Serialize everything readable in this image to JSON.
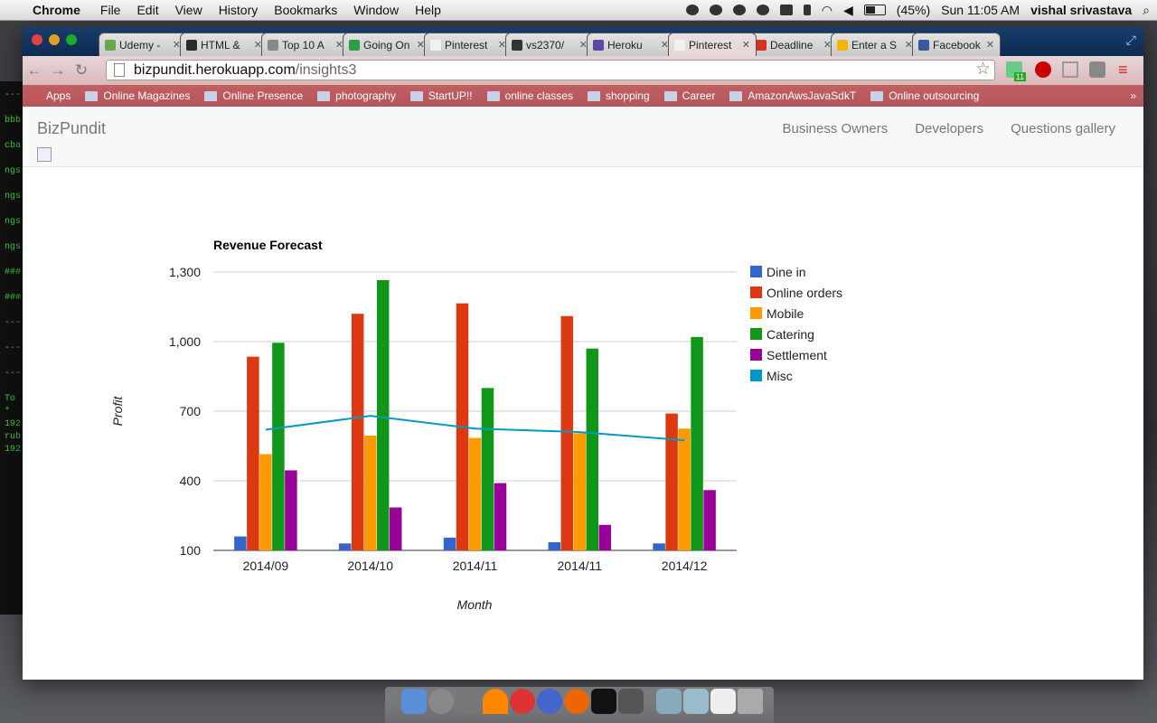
{
  "os_menubar": {
    "app_name": "Chrome",
    "menus": [
      "File",
      "Edit",
      "View",
      "History",
      "Bookmarks",
      "Window",
      "Help"
    ],
    "battery": "(45%)",
    "clock": "Sun 11:05 AM",
    "user": "vishal srivastava"
  },
  "terminal_lines": [
    "---",
    "bbb",
    "cba",
    "ngs",
    "ngs",
    "ngs",
    "ngs",
    "###",
    "###",
    "---",
    "---",
    "---",
    "To",
    " *",
    "192",
    "rub",
    "192"
  ],
  "browser": {
    "tabs": [
      {
        "label": "Udemy -",
        "fav_color": "#6aa84f",
        "active": false
      },
      {
        "label": "HTML &",
        "fav_color": "#2b2b2b",
        "active": false
      },
      {
        "label": "Top 10 A",
        "fav_color": "#888888",
        "active": false
      },
      {
        "label": "Going On",
        "fav_color": "#2e9e44",
        "active": false
      },
      {
        "label": "Pinterest",
        "fav_color": "#f0f0f0",
        "active": false
      },
      {
        "label": "vs2370/",
        "fav_color": "#333333",
        "active": false
      },
      {
        "label": "Heroku",
        "fav_color": "#5a4aa3",
        "active": false
      },
      {
        "label": "Pinterest",
        "fav_color": "#f0f0f0",
        "active": true
      },
      {
        "label": "Deadline",
        "fav_color": "#d93025",
        "active": false
      },
      {
        "label": "Enter a S",
        "fav_color": "#f4b400",
        "active": false
      },
      {
        "label": "Facebook",
        "fav_color": "#3b5998",
        "active": false
      }
    ],
    "url_host": "bizpundit.herokuapp.com",
    "url_path": "/insights3",
    "extension_badge": "11",
    "bookmarks": [
      "Apps",
      "Online Magazines",
      "Online Presence",
      "photography",
      "StartUP!!",
      "online classes",
      "shopping",
      "Career",
      "AmazonAwsJavaSdkT",
      "Online outsourcing"
    ]
  },
  "site": {
    "brand": "BizPundit",
    "nav": [
      "Business Owners",
      "Developers",
      "Questions gallery"
    ]
  },
  "chart_data": {
    "type": "bar",
    "title": "Revenue Forecast",
    "xlabel": "Month",
    "ylabel": "Profit",
    "ylim": [
      100,
      1300
    ],
    "yticks": [
      "1,300",
      "1,000",
      "700",
      "400",
      "100"
    ],
    "ytick_values": [
      1300,
      1000,
      700,
      400,
      100
    ],
    "grid": true,
    "legend_position": "right",
    "categories": [
      "2014/09",
      "2014/10",
      "2014/11",
      "2014/11",
      "2014/12"
    ],
    "series": [
      {
        "name": "Dine in",
        "type": "bar",
        "color": "#3366cc",
        "values": [
          160,
          130,
          155,
          135,
          130
        ]
      },
      {
        "name": "Online orders",
        "type": "bar",
        "color": "#dc3912",
        "values": [
          935,
          1120,
          1165,
          1110,
          690
        ]
      },
      {
        "name": "Mobile",
        "type": "bar",
        "color": "#ff9900",
        "values": [
          515,
          595,
          585,
          605,
          625
        ]
      },
      {
        "name": "Catering",
        "type": "bar",
        "color": "#109618",
        "values": [
          995,
          1265,
          800,
          970,
          1020
        ]
      },
      {
        "name": "Settlement",
        "type": "bar",
        "color": "#990099",
        "values": [
          445,
          285,
          390,
          210,
          360
        ]
      },
      {
        "name": "Misc",
        "type": "line",
        "color": "#0099c6",
        "values": [
          620,
          680,
          625,
          610,
          575
        ]
      }
    ]
  }
}
